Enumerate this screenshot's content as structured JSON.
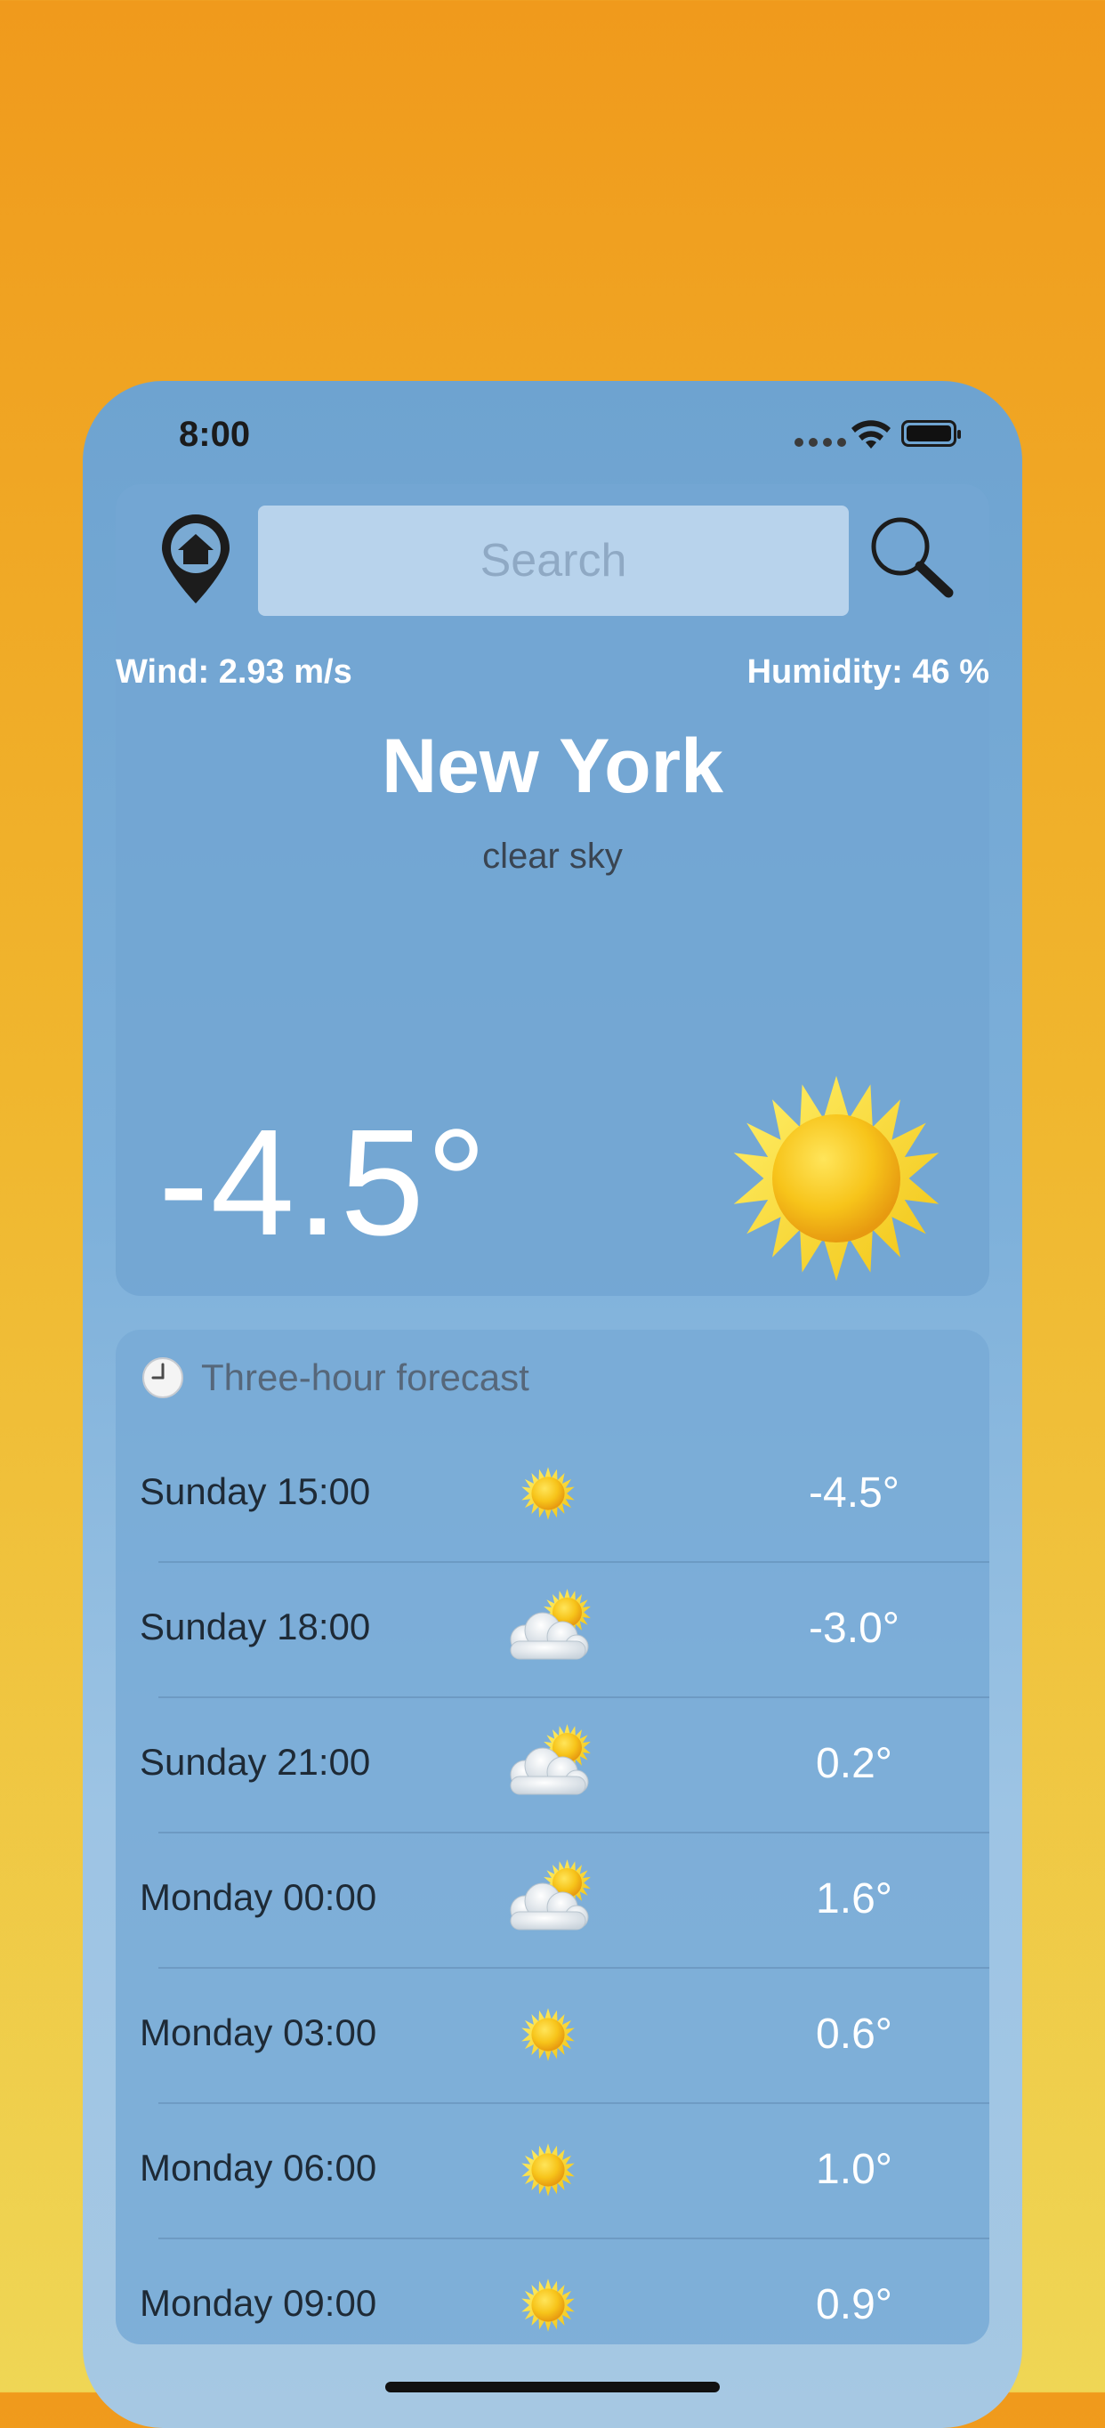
{
  "status_bar": {
    "time": "8:00"
  },
  "search": {
    "placeholder": "Search"
  },
  "current": {
    "wind": "Wind: 2.93 m/s",
    "humidity": "Humidity: 46 %",
    "city": "New York",
    "description": "clear sky",
    "temperature": "-4.5°",
    "icon": "sun-icon"
  },
  "forecast": {
    "title": "Three-hour forecast",
    "rows": [
      {
        "day": "Sunday 15:00",
        "icon": "sun-icon",
        "temp": "-4.5°"
      },
      {
        "day": "Sunday 18:00",
        "icon": "partly-cloudy-icon",
        "temp": "-3.0°"
      },
      {
        "day": "Sunday 21:00",
        "icon": "partly-cloudy-icon",
        "temp": "0.2°"
      },
      {
        "day": "Monday 00:00",
        "icon": "partly-cloudy-icon",
        "temp": "1.6°"
      },
      {
        "day": "Monday 03:00",
        "icon": "sun-icon",
        "temp": "0.6°"
      },
      {
        "day": "Monday 06:00",
        "icon": "sun-icon",
        "temp": "1.0°"
      },
      {
        "day": "Monday 09:00",
        "icon": "sun-icon",
        "temp": "0.9°"
      }
    ]
  },
  "colors": {
    "background_top": "#F09A1C",
    "background_bottom": "#EFD655",
    "card": "#73A6D2",
    "search_field": "#B8D3EC"
  }
}
